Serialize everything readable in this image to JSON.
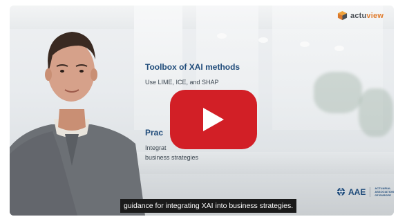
{
  "video": {
    "slide": {
      "title1": "Toolbox of XAI methods",
      "sub1": "Use LIME, ICE, and SHAP",
      "title2": "Prac",
      "sub2a": "Integrat",
      "sub2b": "business strategies"
    },
    "caption": "guidance for integrating XAI into business strategies.",
    "brand": {
      "name_part1": "actu",
      "name_part2": "view",
      "accent_color": "#e07a2a",
      "text_color": "#4a4f55"
    },
    "badge": {
      "name": "AAE",
      "small_text": "ACTUARIAL ASSOCIATION OF EUROPE",
      "color": "#1f4b7a"
    },
    "play_button": {
      "icon": "play-icon",
      "color": "#d21f26"
    }
  }
}
